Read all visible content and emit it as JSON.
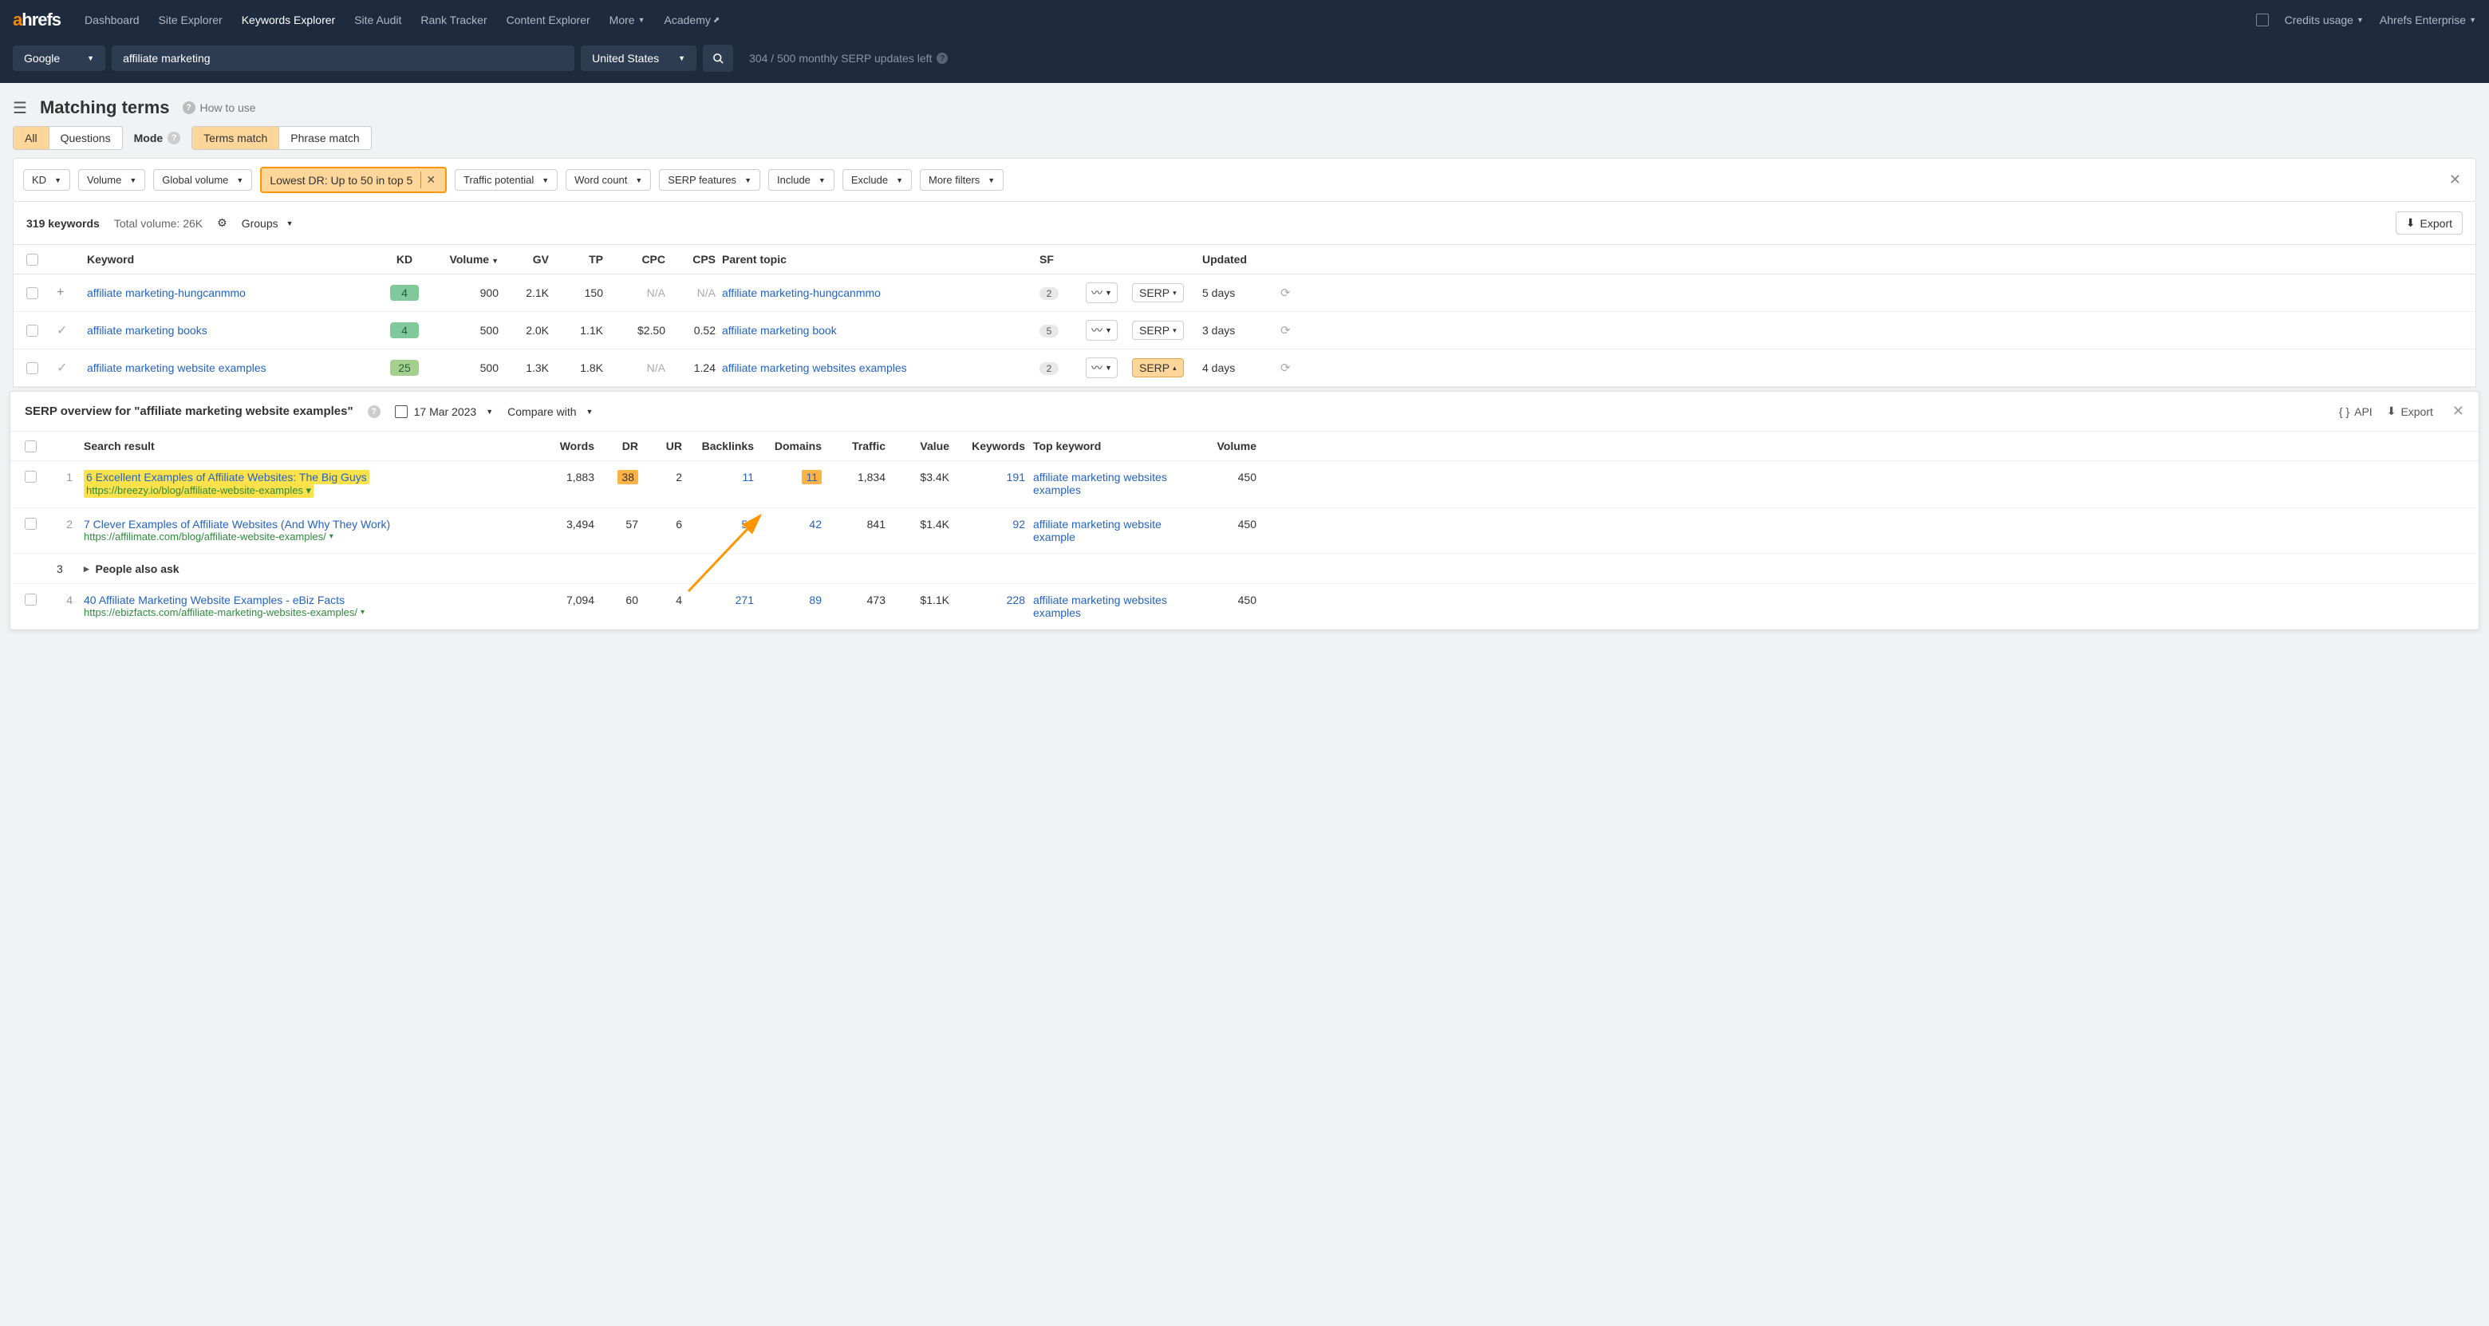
{
  "nav": {
    "brand_a": "a",
    "brand_b": "hrefs",
    "items": [
      "Dashboard",
      "Site Explorer",
      "Keywords Explorer",
      "Site Audit",
      "Rank Tracker",
      "Content Explorer",
      "More"
    ],
    "active_index": 2,
    "academy": "Academy",
    "credits": "Credits usage",
    "account": "Ahrefs Enterprise"
  },
  "search": {
    "engine": "Google",
    "keyword": "affiliate marketing",
    "country": "United States",
    "usage": "304 / 500 monthly SERP updates left"
  },
  "page": {
    "title": "Matching terms",
    "how_to": "How to use"
  },
  "tabs": {
    "all": "All",
    "questions": "Questions",
    "mode": "Mode",
    "terms": "Terms match",
    "phrase": "Phrase match"
  },
  "filters": {
    "kd": "KD",
    "volume": "Volume",
    "global": "Global volume",
    "active": "Lowest DR: Up to 50 in top 5",
    "tp": "Traffic potential",
    "wc": "Word count",
    "serp": "SERP features",
    "include": "Include",
    "exclude": "Exclude",
    "more": "More filters"
  },
  "stats": {
    "count": "319 keywords",
    "total": "Total volume: 26K",
    "groups": "Groups",
    "export": "Export"
  },
  "columns": {
    "keyword": "Keyword",
    "kd": "KD",
    "volume": "Volume",
    "gv": "GV",
    "tp": "TP",
    "cpc": "CPC",
    "cps": "CPS",
    "parent": "Parent topic",
    "sf": "SF",
    "updated": "Updated"
  },
  "rows": [
    {
      "expand": "+",
      "kw": "affiliate marketing-hungcanmmo",
      "kd": "4",
      "kdclass": "",
      "vol": "900",
      "gv": "2.1K",
      "tp": "150",
      "cpc": "N/A",
      "cps": "N/A",
      "parent": "affiliate marketing-hungcanmmo",
      "sf": "2",
      "serp": "SERP",
      "serpdir": "▾",
      "updated": "5 days"
    },
    {
      "expand": "✓",
      "kw": "affiliate marketing books",
      "kd": "4",
      "kdclass": "",
      "vol": "500",
      "gv": "2.0K",
      "tp": "1.1K",
      "cpc": "$2.50",
      "cps": "0.52",
      "parent": "affiliate marketing book",
      "sf": "5",
      "serp": "SERP",
      "serpdir": "▾",
      "updated": "3 days"
    },
    {
      "expand": "✓",
      "kw": "affiliate marketing website examples",
      "kd": "25",
      "kdclass": "g25",
      "vol": "500",
      "gv": "1.3K",
      "tp": "1.8K",
      "cpc": "N/A",
      "cps": "1.24",
      "parent": "affiliate marketing websites examples",
      "sf": "2",
      "serp": "SERP",
      "serpdir": "▴",
      "serpactive": true,
      "updated": "4 days"
    }
  ],
  "serp": {
    "title": "SERP overview for \"affiliate marketing website examples\"",
    "date": "17 Mar 2023",
    "compare": "Compare with",
    "api": "API",
    "export": "Export",
    "cols": {
      "sr": "Search result",
      "words": "Words",
      "dr": "DR",
      "ur": "UR",
      "bl": "Backlinks",
      "dom": "Domains",
      "traffic": "Traffic",
      "value": "Value",
      "kw": "Keywords",
      "top": "Top keyword",
      "vol": "Volume"
    },
    "paa": "People also ask",
    "rows": [
      {
        "pos": "1",
        "title": "6 Excellent Examples of Affiliate Websites: The Big Guys",
        "url": "https://breezy.io/blog/affiliate-website-examples",
        "hl": true,
        "words": "1,883",
        "dr": "38",
        "drhl": true,
        "ur": "2",
        "bl": "11",
        "dom": "11",
        "domhl": true,
        "traffic": "1,834",
        "value": "$3.4K",
        "kw": "191",
        "top": "affiliate marketing websites examples",
        "vol": "450"
      },
      {
        "pos": "2",
        "title": "7 Clever Examples of Affiliate Websites (And Why They Work)",
        "url": "https://affilimate.com/blog/affiliate-website-examples/",
        "words": "3,494",
        "dr": "57",
        "ur": "6",
        "bl": "53",
        "dom": "42",
        "traffic": "841",
        "value": "$1.4K",
        "kw": "92",
        "top": "affiliate marketing website example",
        "vol": "450"
      },
      {
        "pos": "4",
        "title": "40 Affiliate Marketing Website Examples - eBiz Facts",
        "url": "https://ebizfacts.com/affiliate-marketing-websites-examples/",
        "words": "7,094",
        "dr": "60",
        "ur": "4",
        "bl": "271",
        "dom": "89",
        "traffic": "473",
        "value": "$1.1K",
        "kw": "228",
        "top": "affiliate marketing websites examples",
        "vol": "450"
      }
    ]
  }
}
